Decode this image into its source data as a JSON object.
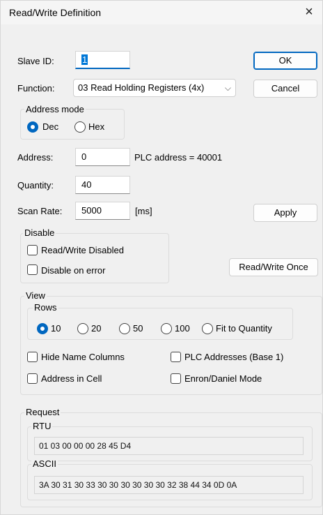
{
  "window": {
    "title": "Read/Write Definition",
    "close_glyph": "×"
  },
  "slave": {
    "label": "Slave ID:",
    "value": "1"
  },
  "function": {
    "label": "Function:",
    "value": "03 Read Holding Registers (4x)",
    "chevron": "⌵"
  },
  "address_mode": {
    "legend": "Address mode",
    "options": [
      "Dec",
      "Hex"
    ],
    "selected": "Dec"
  },
  "address": {
    "label": "Address:",
    "value": "0",
    "plc_address": "PLC address = 40001"
  },
  "quantity": {
    "label": "Quantity:",
    "value": "40"
  },
  "scan_rate": {
    "label": "Scan Rate:",
    "value": "5000",
    "unit": "[ms]"
  },
  "buttons": {
    "ok": "OK",
    "cancel": "Cancel",
    "apply": "Apply",
    "rw_once": "Read/Write Once"
  },
  "disable": {
    "legend": "Disable",
    "rw_disabled": {
      "label": "Read/Write Disabled",
      "checked": false
    },
    "on_error": {
      "label": "Disable on error",
      "checked": false
    }
  },
  "view": {
    "legend": "View",
    "rows": {
      "legend": "Rows",
      "options": [
        "10",
        "20",
        "50",
        "100",
        "Fit to Quantity"
      ],
      "selected": "10"
    },
    "hide_name_columns": {
      "label": "Hide Name Columns",
      "checked": false
    },
    "plc_addresses_base1": {
      "label": "PLC Addresses (Base 1)",
      "checked": false
    },
    "address_in_cell": {
      "label": "Address in Cell",
      "checked": false
    },
    "enron_daniel_mode": {
      "label": "Enron/Daniel Mode",
      "checked": false
    }
  },
  "request": {
    "legend": "Request",
    "rtu": {
      "legend": "RTU",
      "value": "01 03 00 00 00 28 45 D4"
    },
    "ascii": {
      "legend": "ASCII",
      "value": "3A 30 31 30 33 30 30 30 30 30 30 32 38 44 34 0D 0A"
    }
  },
  "colors": {
    "accent": "#0067c0",
    "background": "#f0f0f0"
  }
}
